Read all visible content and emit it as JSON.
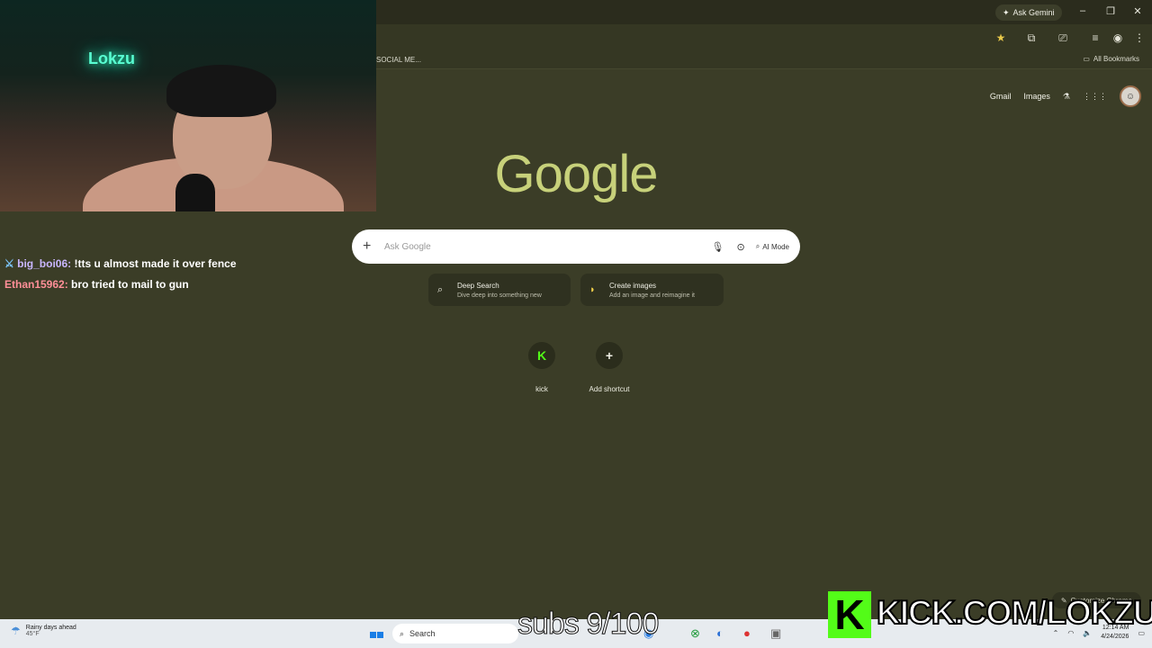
{
  "browser": {
    "ask_gemini": "Ask Gemini",
    "bookmark_partial": "SOCIAL ME...",
    "all_bookmarks": "All Bookmarks"
  },
  "google": {
    "links": {
      "gmail": "Gmail",
      "images": "Images"
    },
    "logo": "Google",
    "search_placeholder": "Ask Google",
    "ai_mode": "AI Mode",
    "chips": [
      {
        "title": "Deep Search",
        "subtitle": "Dive deep into something new"
      },
      {
        "title": "Create images",
        "subtitle": "Add an image and reimagine it"
      }
    ],
    "shortcuts": [
      {
        "label": "kick",
        "glyph": "K"
      },
      {
        "label": "Add shortcut",
        "glyph": "+"
      }
    ],
    "customize": "Customize Chrome"
  },
  "stream": {
    "neon_sign": "Lokzu",
    "chat": [
      {
        "user": "big_boi06:",
        "message": "!tts u almost made it over fence"
      },
      {
        "user": "Ethan15962:",
        "message": "bro tried to mail to gun"
      }
    ],
    "subs": "subs 9/100",
    "kick_url": "KICK.COM/LOKZU"
  },
  "taskbar": {
    "weather_title": "Rainy days ahead",
    "weather_temp": "45°F",
    "search": "Search",
    "time": "12:14 AM",
    "date": "4/24/2026"
  },
  "colors": {
    "accent": "#c7d17a",
    "kick_green": "#53fc18",
    "background": "#3b3d27"
  }
}
